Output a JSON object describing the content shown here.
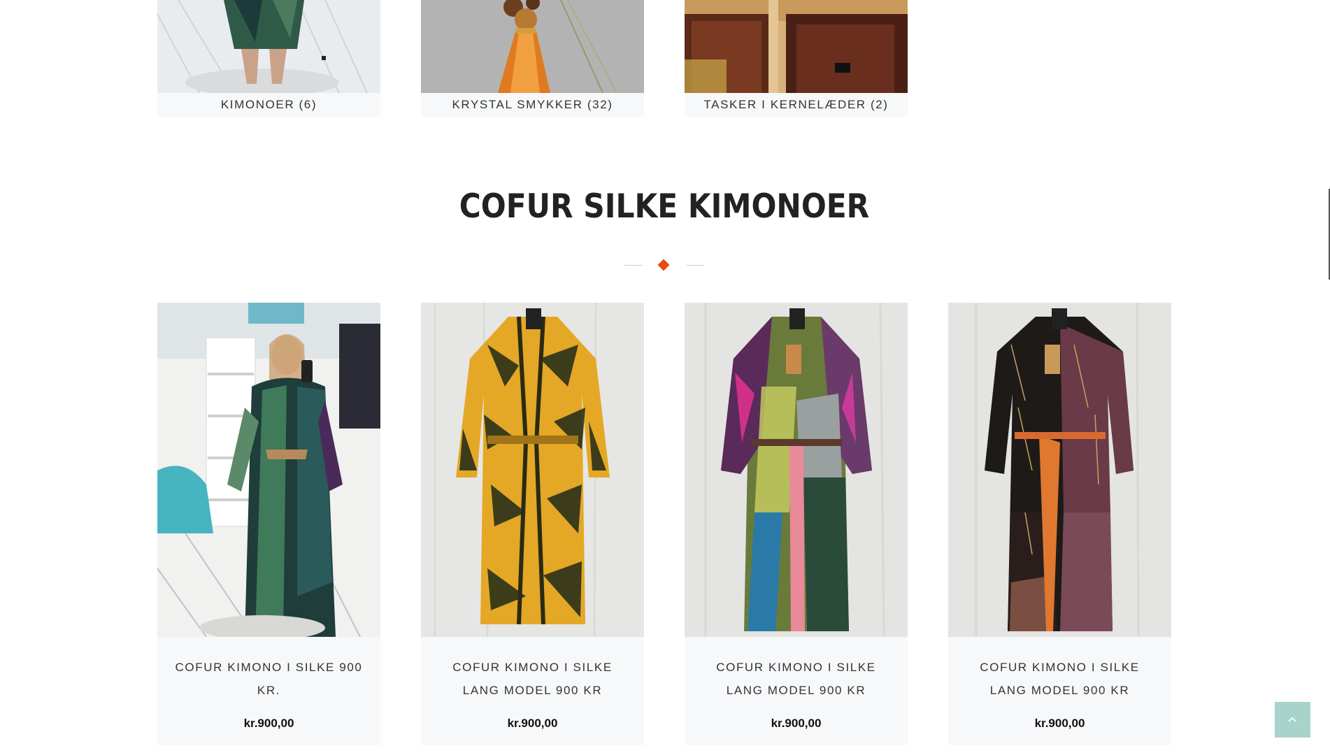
{
  "categories": [
    {
      "label": "KIMONOER (6)",
      "image": "woman-in-tie-dye-kimono-photo"
    },
    {
      "label": "KRYSTAL SMYKKER (32)",
      "image": "buddha-tassel-jewelry-photo"
    },
    {
      "label": "TASKER I KERNELÆDER (2)",
      "image": "leather-bags-on-shelf-photo"
    }
  ],
  "section": {
    "title": "COFUR SILKE KIMONOER"
  },
  "products": [
    {
      "name": "COFUR KIMONO I SILKE 900 KR.",
      "price": "kr.900,00",
      "image": "woman-wearing-green-blue-kimono-photo"
    },
    {
      "name": "COFUR KIMONO I SILKE LANG MODEL 900 KR",
      "price": "kr.900,00",
      "image": "yellow-black-tie-dye-kimono-photo"
    },
    {
      "name": "COFUR KIMONO I SILKE LANG MODEL 900 KR",
      "price": "kr.900,00",
      "image": "multicolor-tie-dye-kimono-photo"
    },
    {
      "name": "COFUR KIMONO I SILKE LANG MODEL 900 KR",
      "price": "kr.900,00",
      "image": "black-burgundy-patterned-kimono-photo"
    }
  ],
  "colors": {
    "accent": "#e84c0e",
    "card_bg": "#f7f8fa",
    "back_to_top": "#a8d3cb"
  },
  "icons": {
    "back_to_top": "chevron-up-icon",
    "divider": "diamond-icon"
  }
}
